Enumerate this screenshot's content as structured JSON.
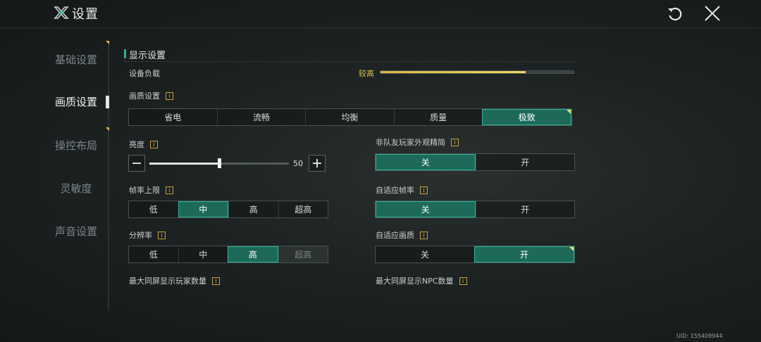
{
  "header": {
    "title": "设置",
    "logo_icon": "game-logo-icon",
    "reset_icon": "reset-icon",
    "close_icon": "close-icon"
  },
  "sidebar": {
    "items": [
      {
        "label": "基础设置",
        "active": false
      },
      {
        "label": "画质设置",
        "active": true
      },
      {
        "label": "操控布局",
        "active": false
      },
      {
        "label": "灵敏度",
        "active": false
      },
      {
        "label": "声音设置",
        "active": false
      }
    ]
  },
  "display": {
    "section_title": "显示设置",
    "device_load": {
      "label": "设备负载",
      "level_text": "较高",
      "percent": 75
    },
    "quality": {
      "label": "画质设置",
      "options": [
        "省电",
        "流畅",
        "均衡",
        "质量",
        "极致"
      ],
      "selected": 4
    },
    "brightness": {
      "label": "亮度",
      "value": "50",
      "min": 0,
      "max": 100,
      "minus_icon": "minus-icon",
      "plus_icon": "plus-icon"
    },
    "fps_limit": {
      "label": "帧率上限",
      "options": [
        "低",
        "中",
        "高",
        "超高"
      ],
      "selected": 1
    },
    "resolution": {
      "label": "分辨率",
      "options": [
        "低",
        "中",
        "高",
        "超高"
      ],
      "selected": 2,
      "disabled": [
        3
      ]
    },
    "max_players": {
      "label": "最大同屏显示玩家数量"
    },
    "non_team_simplify": {
      "label": "非队友玩家外观精简",
      "options": [
        "关",
        "开"
      ],
      "selected": 0
    },
    "adaptive_fps": {
      "label": "自适应帧率",
      "options": [
        "关",
        "开"
      ],
      "selected": 0
    },
    "adaptive_quality": {
      "label": "自适应画质",
      "options": [
        "关",
        "开"
      ],
      "selected": 1
    },
    "max_npc": {
      "label": "最大同屏显示NPC数量"
    },
    "info_glyph": "i"
  },
  "uid": "UID: 155409944",
  "colors": {
    "accent": "#2fb596",
    "selected_bg": "#1d6a5a",
    "highlight": "#e0c04a"
  }
}
